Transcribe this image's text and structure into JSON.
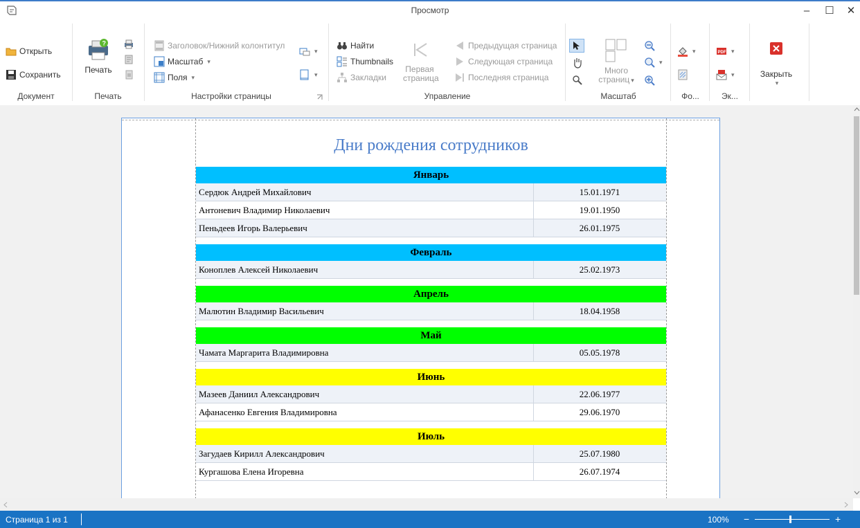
{
  "window": {
    "title": "Просмотр",
    "minimize": "–",
    "maximize": "☐",
    "close": "✕"
  },
  "ribbon": {
    "document": {
      "open": "Открыть",
      "save": "Сохранить",
      "group": "Документ"
    },
    "print": {
      "print": "Печать",
      "group": "Печать"
    },
    "page_setup": {
      "header_footer": "Заголовок/Нижний колонтитул",
      "scale": "Масштаб",
      "margins": "Поля",
      "group": "Настройки страницы"
    },
    "navigation": {
      "find": "Найти",
      "thumbnails": "Thumbnails",
      "bookmarks": "Закладки",
      "first_page_line1": "Первая",
      "first_page_line2": "страница",
      "prev_page": "Предыдущая страница",
      "next_page": "Следующая страница",
      "last_page": "Последняя страница",
      "group": "Управление"
    },
    "zoom": {
      "many_pages_line1": "Много",
      "many_pages_line2": "страниц",
      "group": "Масштаб"
    },
    "background": {
      "group": "Фо..."
    },
    "export": {
      "group": "Эк..."
    },
    "close": {
      "label": "Закрыть"
    }
  },
  "report": {
    "title": "Дни рождения сотрудников",
    "months": [
      {
        "name": "Январь",
        "color": "#00bfff",
        "rows": [
          {
            "name": "Сердюк Андрей Михайлович",
            "date": "15.01.1971"
          },
          {
            "name": "Антоневич Владимир Николаевич",
            "date": "19.01.1950"
          },
          {
            "name": "Пеньдеев Игорь Валерьевич",
            "date": "26.01.1975"
          }
        ]
      },
      {
        "name": "Февраль",
        "color": "#00bfff",
        "rows": [
          {
            "name": "Коноплев Алексей Николаевич",
            "date": "25.02.1973"
          }
        ]
      },
      {
        "name": "Апрель",
        "color": "#00ff00",
        "rows": [
          {
            "name": "Малютин Владимир Васильевич",
            "date": "18.04.1958"
          }
        ]
      },
      {
        "name": "Май",
        "color": "#00ff00",
        "rows": [
          {
            "name": "Чамата Маргарита Владимировна",
            "date": "05.05.1978"
          }
        ]
      },
      {
        "name": "Июнь",
        "color": "#ffff00",
        "rows": [
          {
            "name": "Мазеев Даниил Александрович",
            "date": "22.06.1977"
          },
          {
            "name": "Афанасенко Евгения Владимировна",
            "date": "29.06.1970"
          }
        ]
      },
      {
        "name": "Июль",
        "color": "#ffff00",
        "rows": [
          {
            "name": "Загудаев Кирилл Александрович",
            "date": "25.07.1980"
          },
          {
            "name": "Кургашова Елена Игоревна",
            "date": "26.07.1974"
          }
        ]
      }
    ]
  },
  "status": {
    "page": "Страница 1 из 1",
    "zoom": "100%",
    "zoom_out": "−",
    "zoom_in": "+"
  }
}
